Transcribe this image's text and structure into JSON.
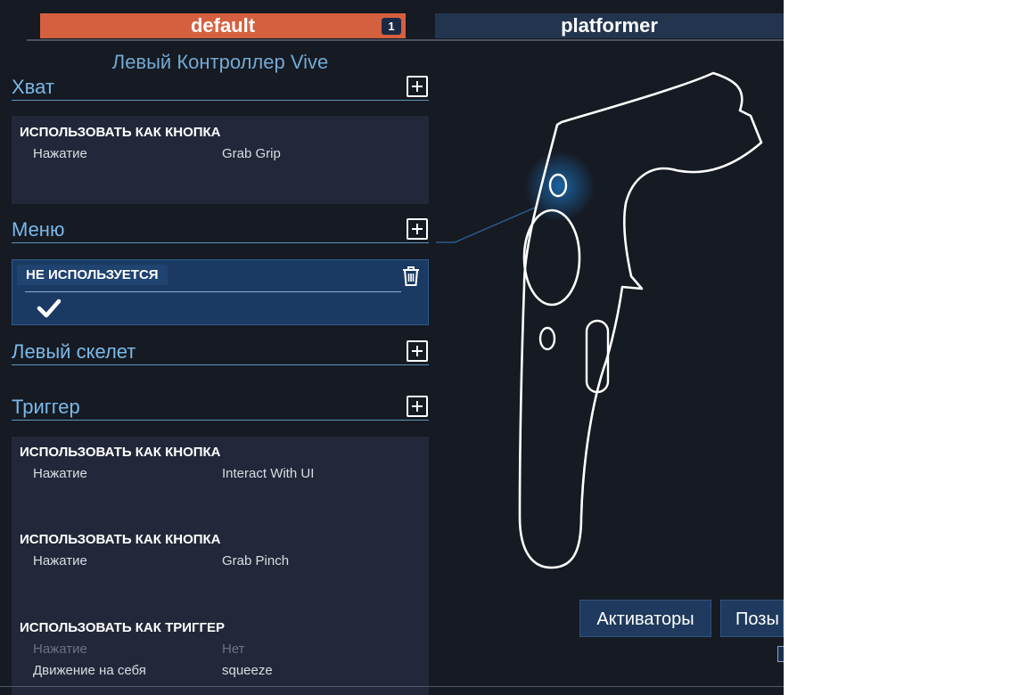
{
  "tabs": {
    "default_label": "default",
    "default_badge": "1",
    "platformer_label": "platformer"
  },
  "controller": {
    "title": "Левый Контроллер Vive"
  },
  "sections": {
    "grip": {
      "title": "Хват",
      "bindings": [
        {
          "type": "ИСПОЛЬЗОВАТЬ КАК КНОПКА",
          "label": "Нажатие",
          "value": "Grab Grip"
        }
      ]
    },
    "menu": {
      "title": "Меню",
      "selected": {
        "label": "НЕ ИСПОЛЬЗУЕТСЯ"
      }
    },
    "skeleton": {
      "title": "Левый скелет"
    },
    "trigger": {
      "title": "Триггер",
      "bindings": [
        {
          "type": "ИСПОЛЬЗОВАТЬ КАК КНОПКА",
          "label": "Нажатие",
          "value": "Interact With UI"
        },
        {
          "type": "ИСПОЛЬЗОВАТЬ КАК КНОПКА",
          "label": "Нажатие",
          "value": "Grab Pinch"
        },
        {
          "type": "ИСПОЛЬЗОВАТЬ КАК ТРИГГЕР",
          "rows": [
            {
              "label": "Нажатие",
              "value": "Нет"
            },
            {
              "label": "Движение на себя",
              "value": "squeeze"
            }
          ]
        }
      ]
    }
  },
  "buttons": {
    "activators": "Активаторы",
    "poses": "Позы"
  },
  "colors": {
    "background": "#161a22",
    "active_tab": "#d5603f",
    "inactive_tab": "#23344f",
    "accent_text": "#7ab9ea",
    "card": "#222839",
    "selected": "#1b3a63",
    "highlight_glow": "#1c6fb8"
  },
  "icons": {
    "add": "plus-square-icon",
    "delete": "trash-icon",
    "confirm": "check-icon",
    "controller": "vive-controller-outline"
  }
}
